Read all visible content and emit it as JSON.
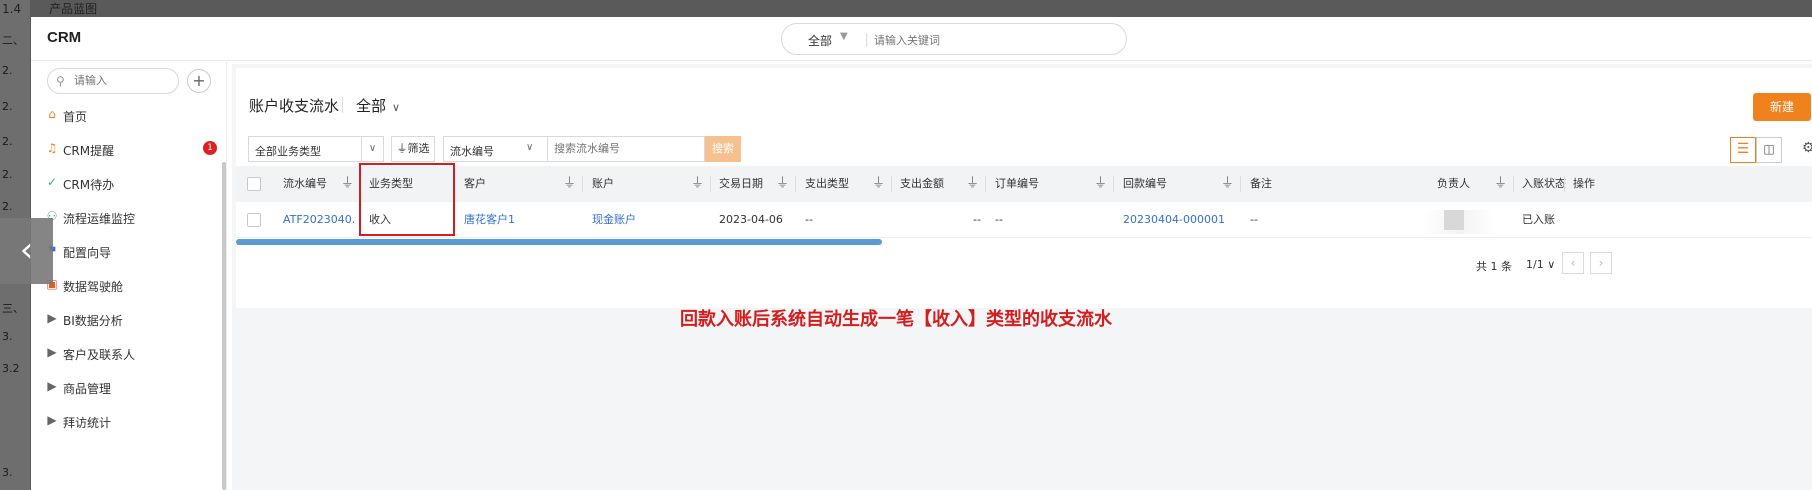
{
  "background": {
    "top_title_num": "1.4",
    "top_title": "产品蓝图",
    "left_lines": [
      "二、",
      "2.",
      "2.",
      "2.",
      "2.",
      "2.",
      "三、",
      "3.",
      "3.2",
      "3."
    ]
  },
  "app": {
    "title": "CRM"
  },
  "global_search": {
    "scope": "全部",
    "placeholder": "请输入关键词"
  },
  "sidebar": {
    "search_placeholder": "请输入",
    "add_symbol": "+",
    "items": [
      {
        "label": "首页",
        "icon": "home-icon",
        "glyph": "⌂",
        "color": "#f0821d"
      },
      {
        "label": "CRM提醒",
        "icon": "bell-icon",
        "glyph": "🔔",
        "color": "#f0821d",
        "badge": "1"
      },
      {
        "label": "CRM待办",
        "icon": "check-circle-icon",
        "glyph": "✓",
        "color": "#3cb371"
      },
      {
        "label": "流程运维监控",
        "icon": "flow-icon",
        "glyph": "⚇",
        "color": "#3cb371"
      },
      {
        "label": "配置向导",
        "icon": "flag-icon",
        "glyph": "⚑",
        "color": "#3370d0"
      },
      {
        "label": "数据驾驶舱",
        "icon": "dashboard-icon",
        "glyph": "▣",
        "color": "#e05a2a"
      },
      {
        "label": "BI数据分析",
        "icon": "caret-right-icon",
        "glyph": "▶",
        "color": "#666"
      },
      {
        "label": "客户及联系人",
        "icon": "caret-right-icon",
        "glyph": "▶",
        "color": "#666"
      },
      {
        "label": "商品管理",
        "icon": "caret-right-icon",
        "glyph": "▶",
        "color": "#666"
      },
      {
        "label": "拜访统计",
        "icon": "caret-right-icon",
        "glyph": "▶",
        "color": "#666"
      }
    ]
  },
  "page": {
    "title": "账户收支流水",
    "scope": "全部",
    "new_button": "新建",
    "more_button": "···"
  },
  "filters": {
    "business_type": "全部业务类型",
    "filter_button": "筛选",
    "serial_field": "流水编号",
    "serial_placeholder": "搜索流水编号",
    "search_button": "搜索"
  },
  "table": {
    "columns": [
      "流水编号",
      "业务类型",
      "客户",
      "账户",
      "交易日期",
      "支出类型",
      "支出金额",
      "订单编号",
      "回款编号",
      "备注",
      "负责人",
      "入账状态",
      "操作"
    ],
    "rows": [
      {
        "serial": "ATF2023040...",
        "type": "收入",
        "customer": "唐花客户1",
        "account": "现金账户",
        "date": "2023-04-06",
        "expense_type": "--",
        "expense_amount": "--",
        "order_no": "--",
        "payment_no": "20230404-000001",
        "remark": "--",
        "owner": "",
        "status": "已入账"
      }
    ],
    "scroll_fraction": 0.41
  },
  "pagination": {
    "total": "共 1 条",
    "page": "1/1",
    "prev": "‹",
    "next": "›"
  },
  "annotation": "回款入账后系统自动生成一笔【收入】类型的收支流水",
  "colors": {
    "accent": "#f0821d",
    "link": "#3370d0",
    "highlight": "#d61d1d"
  }
}
